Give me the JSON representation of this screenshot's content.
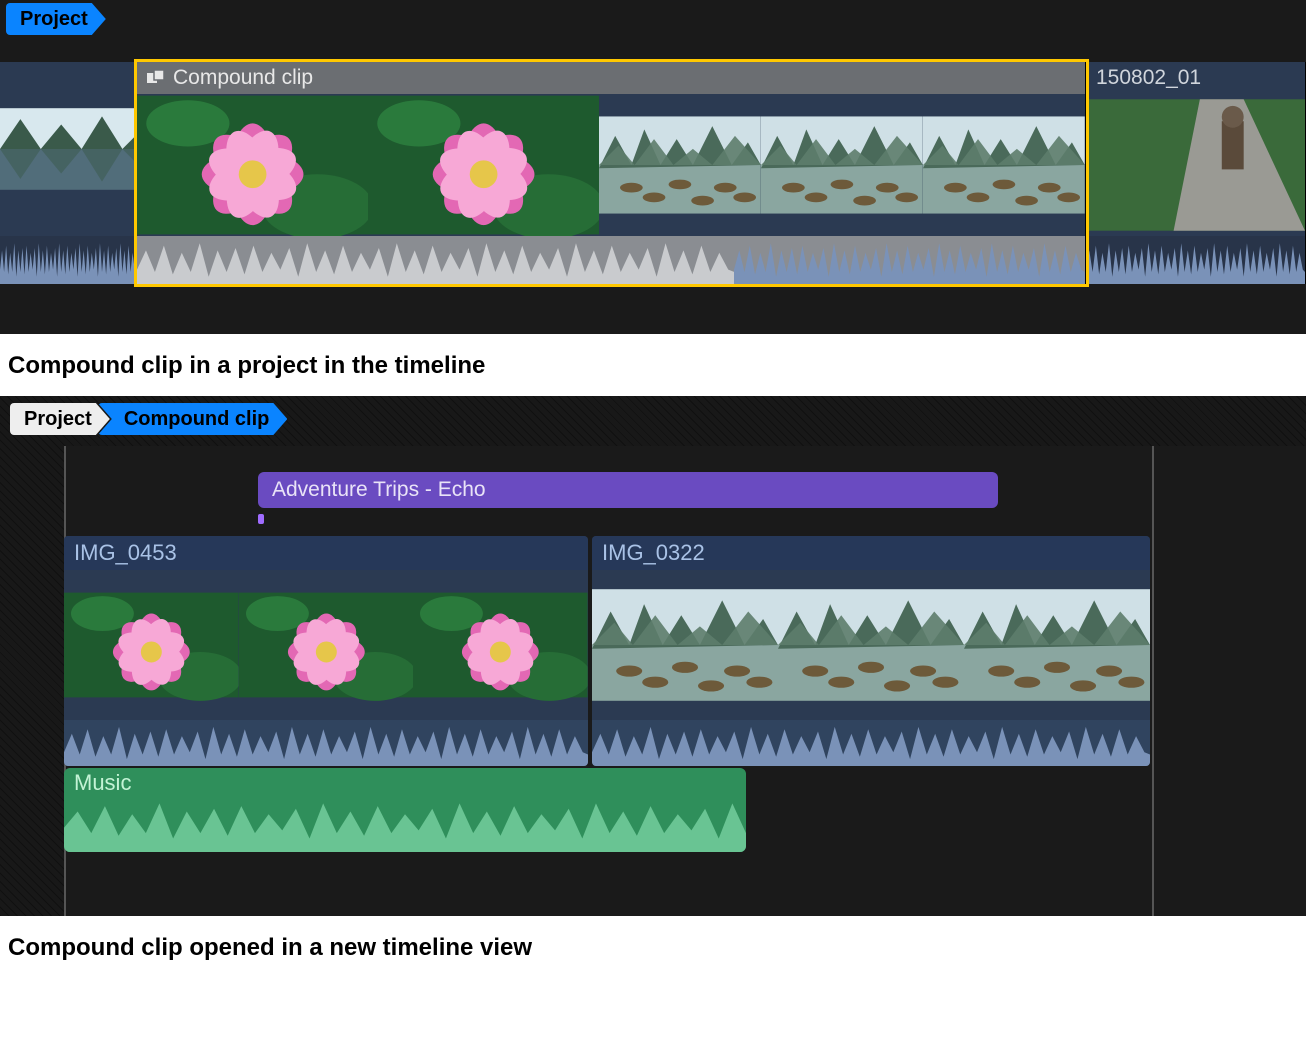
{
  "top_timeline": {
    "breadcrumb": [
      "Project"
    ],
    "left_clip_label": "",
    "compound_clip": {
      "label": "Compound clip"
    },
    "right_clip_label": "150802_01"
  },
  "caption1": "Compound clip in a project in the timeline",
  "open_timeline": {
    "breadcrumb": [
      "Project",
      "Compound clip"
    ],
    "title_clip": "Adventure Trips - Echo",
    "video_clips": [
      "IMG_0453",
      "IMG_0322"
    ],
    "audio_clip": "Music"
  },
  "caption2": "Compound clip opened in a new timeline view"
}
